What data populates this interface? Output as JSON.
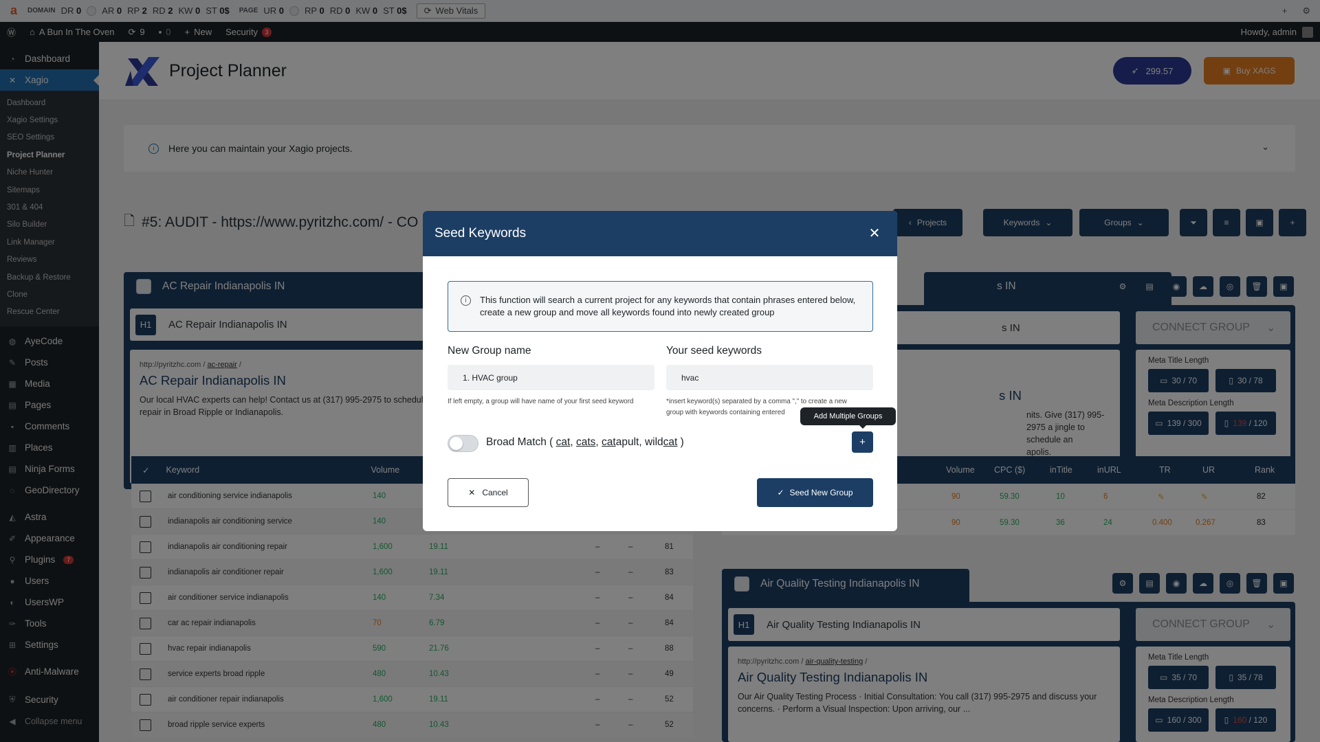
{
  "ext_bar": {
    "domain_label": "DOMAIN",
    "page_label": "PAGE",
    "domain_metrics": [
      {
        "k": "DR",
        "v": "0"
      },
      {
        "k": "AR",
        "v": "0"
      },
      {
        "k": "RP",
        "v": "2"
      },
      {
        "k": "RD",
        "v": "2"
      },
      {
        "k": "KW",
        "v": "0"
      },
      {
        "k": "ST",
        "v": "0$"
      }
    ],
    "page_metrics": [
      {
        "k": "UR",
        "v": "0"
      },
      {
        "k": "RP",
        "v": "0"
      },
      {
        "k": "RD",
        "v": "0"
      },
      {
        "k": "KW",
        "v": "0"
      },
      {
        "k": "ST",
        "v": "0$"
      }
    ],
    "web_vitals": "Web Vitals"
  },
  "admin_bar": {
    "site_name": "A Bun In The Oven",
    "updates": "9",
    "comments": "0",
    "new_label": "New",
    "security_label": "Security",
    "security_count": "3",
    "howdy": "Howdy, admin"
  },
  "sidebar": {
    "dashboard": "Dashboard",
    "xagio": "Xagio",
    "sub_items": [
      "Dashboard",
      "Xagio Settings",
      "SEO Settings",
      "Project Planner",
      "Niche Hunter",
      "Sitemaps",
      "301 & 404",
      "Silo Builder",
      "Link Manager",
      "Reviews",
      "Backup & Restore",
      "Clone",
      "Rescue Center"
    ],
    "current_sub": "Project Planner",
    "items": [
      {
        "label": "AyeCode",
        "icon": "ayecode-icon"
      },
      {
        "label": "Posts",
        "icon": "pin-icon"
      },
      {
        "label": "Media",
        "icon": "media-icon"
      },
      {
        "label": "Pages",
        "icon": "pages-icon"
      },
      {
        "label": "Comments",
        "icon": "comment-icon"
      },
      {
        "label": "Places",
        "icon": "places-icon"
      },
      {
        "label": "Ninja Forms",
        "icon": "forms-icon"
      },
      {
        "label": "GeoDirectory",
        "icon": "globe-icon"
      }
    ],
    "items2": [
      {
        "label": "Astra",
        "icon": "astra-icon"
      },
      {
        "label": "Appearance",
        "icon": "brush-icon"
      },
      {
        "label": "Plugins",
        "icon": "plug-icon",
        "badge": "7"
      },
      {
        "label": "Users",
        "icon": "user-icon"
      },
      {
        "label": "UsersWP",
        "icon": "userswp-icon"
      },
      {
        "label": "Tools",
        "icon": "wrench-icon"
      },
      {
        "label": "Settings",
        "icon": "settings-icon"
      }
    ],
    "anti_malware": "Anti-Malware",
    "security": "Security",
    "collapse": "Collapse menu"
  },
  "header": {
    "title": "Project Planner",
    "balance": "299.57",
    "buy_label": "Buy XAGS"
  },
  "info_panel": {
    "text": "Here you can maintain your Xagio projects."
  },
  "project": {
    "title": "#5: AUDIT - https://www.pyritzhc.com/ - CO",
    "buttons": {
      "projects": "Projects",
      "keywords": "Keywords",
      "groups": "Groups"
    }
  },
  "group1": {
    "name": "AC Repair Indianapolis IN",
    "h1_badge": "H1",
    "h1": "AC Repair Indianapolis IN",
    "url_host": "http://pyritzhc.com",
    "url_path": "ac-repair",
    "serp_title": "AC Repair Indianapolis IN",
    "serp_desc_1": "Our local HVAC experts can help! Contact us at (317) 995-2975 to schedule",
    "serp_desc_2": "repair in Broad Ripple or Indianapolis."
  },
  "group2": {
    "name_tail": "s IN",
    "h1_tail": "s IN",
    "serp_title_tail": "s IN",
    "serp_desc_1": "nits. Give (317) 995-2975 a jingle to schedule an",
    "serp_desc_2": "apolis.",
    "connect": "CONNECT GROUP",
    "meta_title_label": "Meta Title Length",
    "meta_title_desktop": "30 / 70",
    "meta_title_mobile": "30 / 78",
    "meta_desc_label": "Meta Description Length",
    "meta_desc_desktop": "139 / 300",
    "meta_desc_mobile_over": "139",
    "meta_desc_mobile_max": " / 120"
  },
  "group3": {
    "name": "Air Quality Testing Indianapolis IN",
    "h1_badge": "H1",
    "h1": "Air Quality Testing Indianapolis IN",
    "connect": "CONNECT GROUP",
    "url_host": "http://pyritzhc.com",
    "url_path": "air-quality-testing",
    "serp_title": "Air Quality Testing Indianapolis IN",
    "serp_desc_1": "Our Air Quality Testing Process · Initial Consultation: You call (317) 995-2975 and discuss your",
    "serp_desc_2": "concerns. · Perform a Visual Inspection: Upon arriving, our ...",
    "meta_title_label": "Meta Title Length",
    "meta_title_desktop": "35 / 70",
    "meta_title_mobile": "35 / 78",
    "meta_desc_label": "Meta Description Length",
    "meta_desc_desktop": "160 / 300",
    "meta_desc_mobile_over": "160",
    "meta_desc_mobile_max": " / 120"
  },
  "keywords_table": {
    "headers": {
      "keyword": "Keyword",
      "volume": "Volume"
    },
    "rows": [
      {
        "keyword": "air conditioning service indianapolis",
        "volume": "140",
        "cpc": "",
        "a": "",
        "b": "",
        "rank": ""
      },
      {
        "keyword": "indianapolis air conditioning service",
        "volume": "140",
        "cpc": "",
        "a": "",
        "b": "",
        "rank": ""
      },
      {
        "keyword": "indianapolis air conditioning repair",
        "volume": "1,600",
        "cpc": "19.11",
        "a": "–",
        "b": "–",
        "rank": "81"
      },
      {
        "keyword": "indianapolis air conditioner repair",
        "volume": "1,600",
        "cpc": "19.11",
        "a": "–",
        "b": "–",
        "rank": "83"
      },
      {
        "keyword": "air conditioner service indianapolis",
        "volume": "140",
        "cpc": "7.34",
        "a": "–",
        "b": "–",
        "rank": "84"
      },
      {
        "keyword": "car ac repair indianapolis",
        "volume": "70",
        "cpc": "6.79",
        "a": "–",
        "b": "–",
        "rank": "84"
      },
      {
        "keyword": "hvac repair indianapolis",
        "volume": "590",
        "cpc": "21.76",
        "a": "–",
        "b": "–",
        "rank": "88"
      },
      {
        "keyword": "service experts broad ripple",
        "volume": "480",
        "cpc": "10.43",
        "a": "–",
        "b": "–",
        "rank": "49"
      },
      {
        "keyword": "air conditioner repair indianapolis",
        "volume": "1,600",
        "cpc": "19.11",
        "a": "–",
        "b": "–",
        "rank": "52"
      },
      {
        "keyword": "broad ripple service experts",
        "volume": "480",
        "cpc": "10.43",
        "a": "–",
        "b": "–",
        "rank": "52"
      }
    ],
    "volume_colors": [
      "green",
      "green",
      "green",
      "green",
      "green",
      "orange",
      "green",
      "green",
      "green",
      "green"
    ]
  },
  "right_table": {
    "headers": [
      "Volume",
      "CPC ($)",
      "inTitle",
      "inURL",
      "TR",
      "UR",
      "Rank"
    ],
    "rows": [
      {
        "volume": "90",
        "cpc": "59.30",
        "intitle": "10",
        "inurl": "6",
        "tr": "",
        "ur": "",
        "rank": "82"
      },
      {
        "volume": "90",
        "cpc": "59.30",
        "intitle": "36",
        "inurl": "24",
        "tr": "0.400",
        "ur": "0.267",
        "rank": "83"
      }
    ]
  },
  "modal": {
    "title": "Seed Keywords",
    "info": "This function will search a current project for any keywords that contain phrases entered below, create a new group and move all keywords found into newly created group",
    "group_name_label": "New Group name",
    "group_name_value": "1. HVAC group",
    "group_name_hint": "If left empty, a group will have name of your first seed keyword",
    "seed_label": "Your seed keywords",
    "seed_value": "hvac",
    "seed_hint_1": "*insert keyword(s) separated by a comma \",\" to create a new",
    "seed_hint_2": "group with keywords containing entered",
    "broad_match_prefix": "Broad Match ( ",
    "bm_cat": "cat",
    "bm_cats": "cats",
    "bm_catapult_cat": "cat",
    "bm_catapult_rest": "apult",
    "bm_wildcat_wild": "wild",
    "bm_wildcat_cat": "cat",
    "add_multiple_tooltip": "Add Multiple Groups",
    "cancel": "Cancel",
    "seed_new_group": "Seed New Group"
  }
}
